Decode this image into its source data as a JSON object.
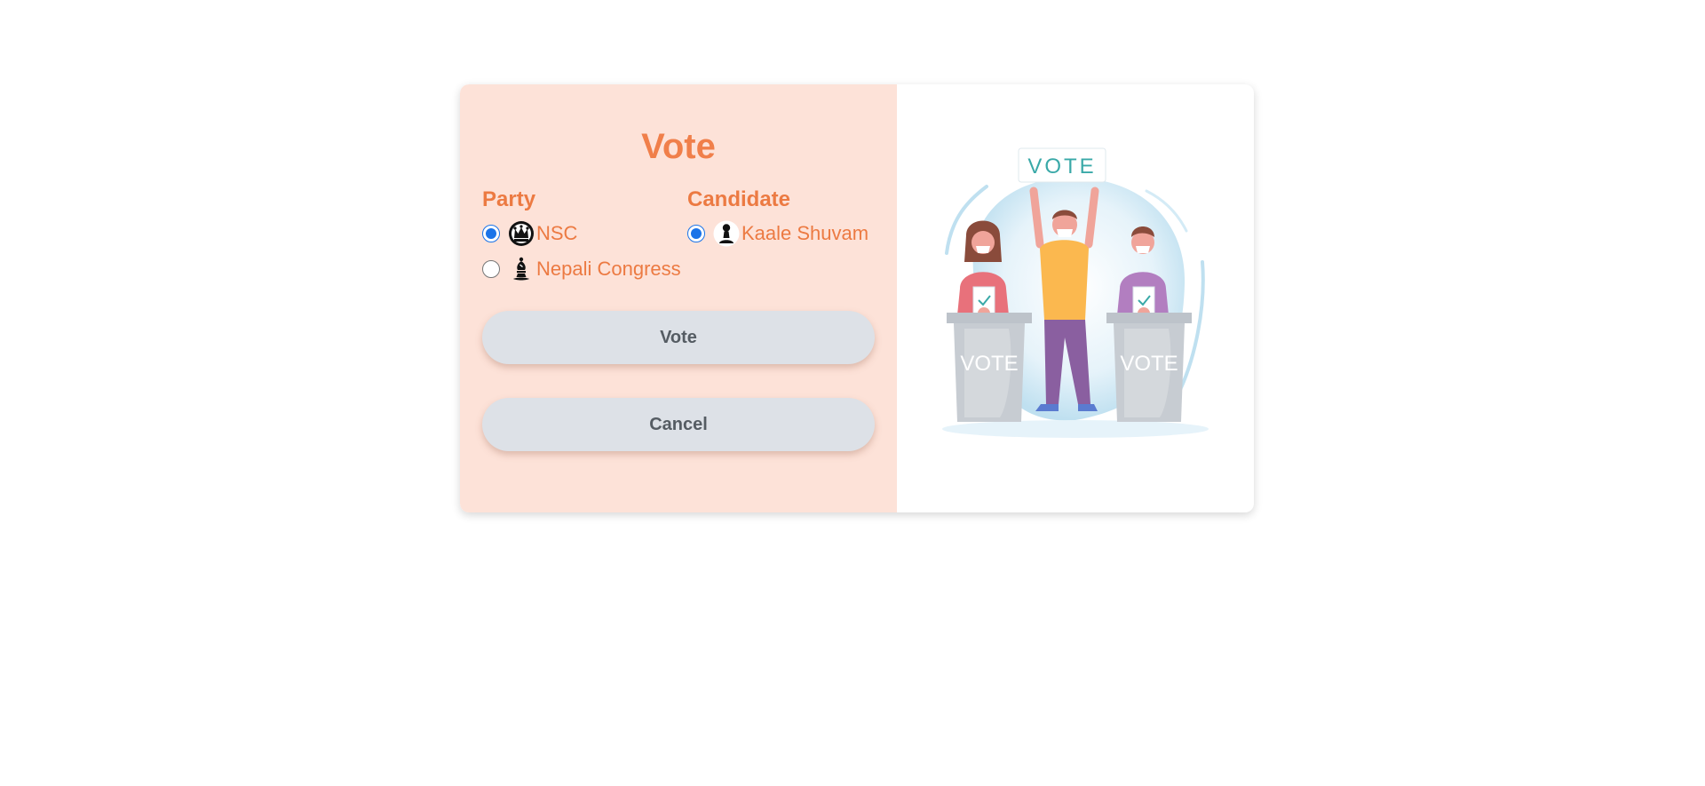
{
  "form": {
    "title": "Vote",
    "party": {
      "heading": "Party",
      "options": [
        {
          "label": "NSC",
          "icon": "crown-emblem-icon",
          "checked": true
        },
        {
          "label": "Nepali Congress",
          "icon": "bishop-emblem-icon",
          "checked": false
        }
      ]
    },
    "candidate": {
      "heading": "Candidate",
      "options": [
        {
          "label": "Kaale Shuvam",
          "icon": "pawn-icon",
          "checked": true
        }
      ]
    },
    "vote_button": "Vote",
    "cancel_button": "Cancel"
  },
  "illustration": {
    "sign_text": "VOTE",
    "box_left_text": "VOTE",
    "box_right_text": "VOTE"
  },
  "colors": {
    "accent": "#f07f4a",
    "form_background": "#fde2d8",
    "button": "#dde1e7"
  }
}
